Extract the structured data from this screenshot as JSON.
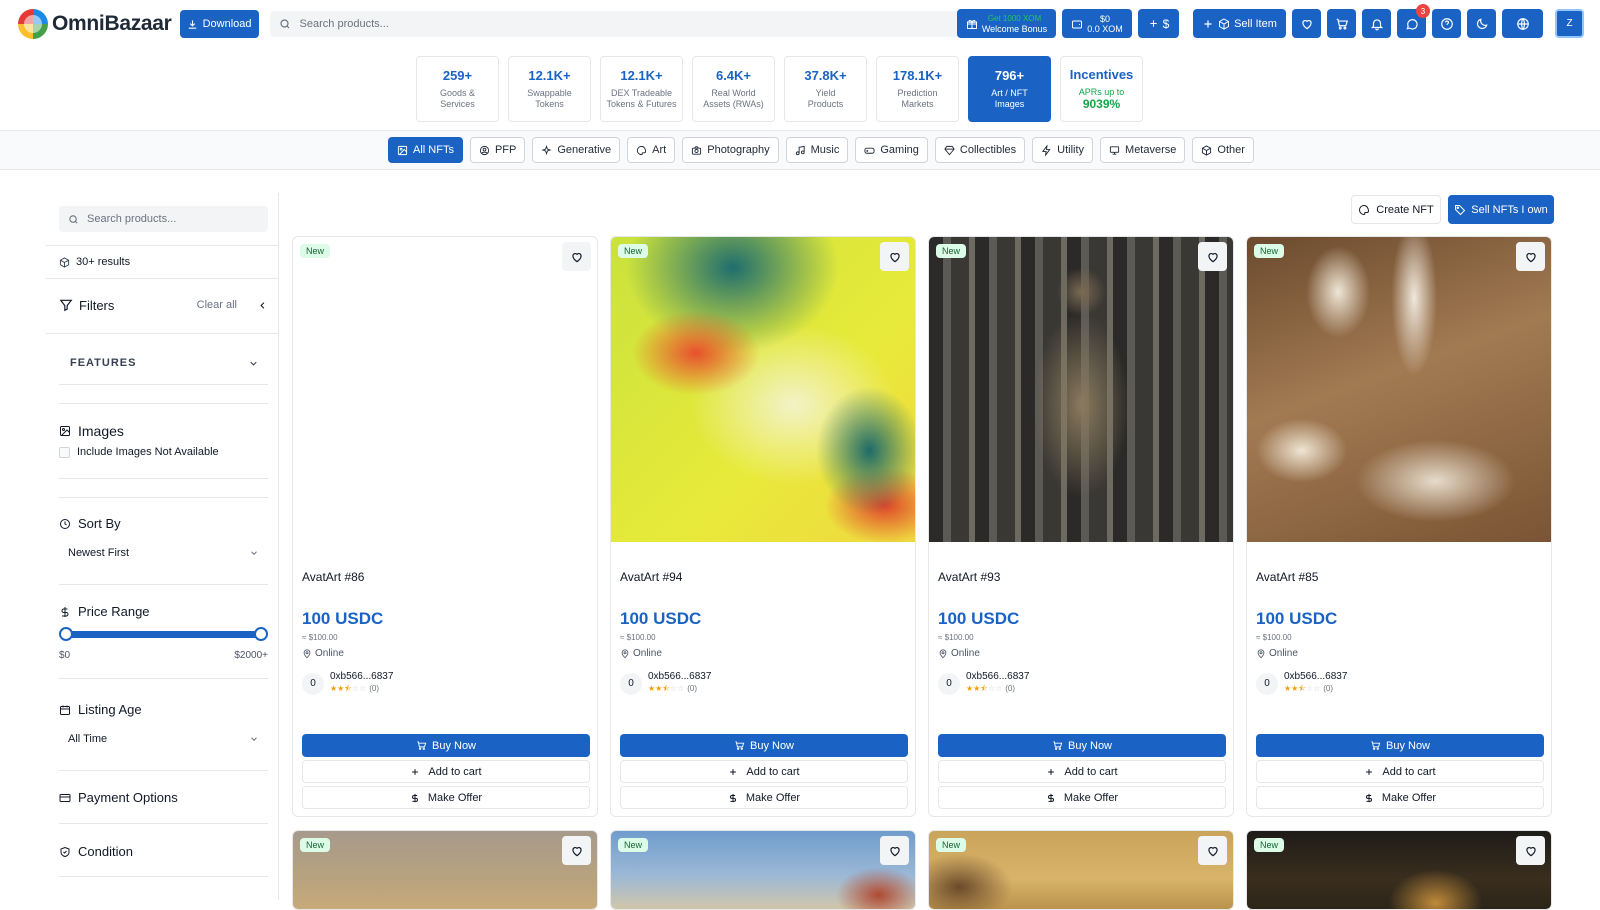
{
  "header": {
    "logo_text": "OmniBazaar",
    "download_label": "Download",
    "search_placeholder": "Search products...",
    "bonus_top": "Get 1000 XOM",
    "bonus_label": "Welcome Bonus",
    "wallet_usd": "$0",
    "wallet_xom": "0.0 XOM",
    "plus_dollar": "$",
    "sell_label": "Sell Item",
    "messages_badge": "3",
    "avatar_letter": "Z"
  },
  "stats": [
    {
      "num": "259+",
      "l1": "Goods &",
      "l2": "Services"
    },
    {
      "num": "12.1K+",
      "l1": "Swappable",
      "l2": "Tokens"
    },
    {
      "num": "12.1K+",
      "l1": "DEX Tradeable",
      "l2": "Tokens & Futures"
    },
    {
      "num": "6.4K+",
      "l1": "Real World",
      "l2": "Assets (RWAs)"
    },
    {
      "num": "37.8K+",
      "l1": "Yield",
      "l2": "Products"
    },
    {
      "num": "178.1K+",
      "l1": "Prediction",
      "l2": "Markets"
    },
    {
      "num": "796+",
      "l1": "Art / NFT",
      "l2": "Images"
    }
  ],
  "incentives": {
    "title": "Incentives",
    "apr_label": "APRs up to",
    "apr_value": "9039%"
  },
  "categories": [
    "All NFTs",
    "PFP",
    "Generative",
    "Art",
    "Photography",
    "Music",
    "Gaming",
    "Collectibles",
    "Utility",
    "Metaverse",
    "Other"
  ],
  "sidebar": {
    "search_placeholder": "Search products...",
    "results": "30+ results",
    "filters_title": "Filters",
    "clear_all": "Clear all",
    "features_title": "FEATURES",
    "images_title": "Images",
    "images_checkbox": "Include Images Not Available",
    "sort_title": "Sort By",
    "sort_value": "Newest First",
    "price_title": "Price Range",
    "price_min": "$0",
    "price_max": "$2000+",
    "listing_title": "Listing Age",
    "listing_value": "All Time",
    "payment_title": "Payment Options",
    "condition_title": "Condition"
  },
  "main": {
    "create_nft": "Create NFT",
    "sell_nfts": "Sell NFTs I own"
  },
  "card_labels": {
    "new": "New",
    "buy": "Buy Now",
    "cart": "Add to cart",
    "offer": "Make Offer"
  },
  "cards": [
    {
      "name": "AvatArt #86",
      "price": "100 USDC",
      "usd": "≈ $100.00",
      "loc": "Online",
      "seller_initial": "0",
      "seller": "0xb566...6837",
      "rating_count": "(0)",
      "rating": 2.5
    },
    {
      "name": "AvatArt #94",
      "price": "100 USDC",
      "usd": "≈ $100.00",
      "loc": "Online",
      "seller_initial": "0",
      "seller": "0xb566...6837",
      "rating_count": "(0)",
      "rating": 2.5
    },
    {
      "name": "AvatArt #93",
      "price": "100 USDC",
      "usd": "≈ $100.00",
      "loc": "Online",
      "seller_initial": "0",
      "seller": "0xb566...6837",
      "rating_count": "(0)",
      "rating": 2.5
    },
    {
      "name": "AvatArt #85",
      "price": "100 USDC",
      "usd": "≈ $100.00",
      "loc": "Online",
      "seller_initial": "0",
      "seller": "0xb566...6837",
      "rating_count": "(0)",
      "rating": 2.5
    }
  ],
  "colors": {
    "brand": "#1a63c4",
    "positive": "#16a34a",
    "badge": "#ef4444"
  }
}
